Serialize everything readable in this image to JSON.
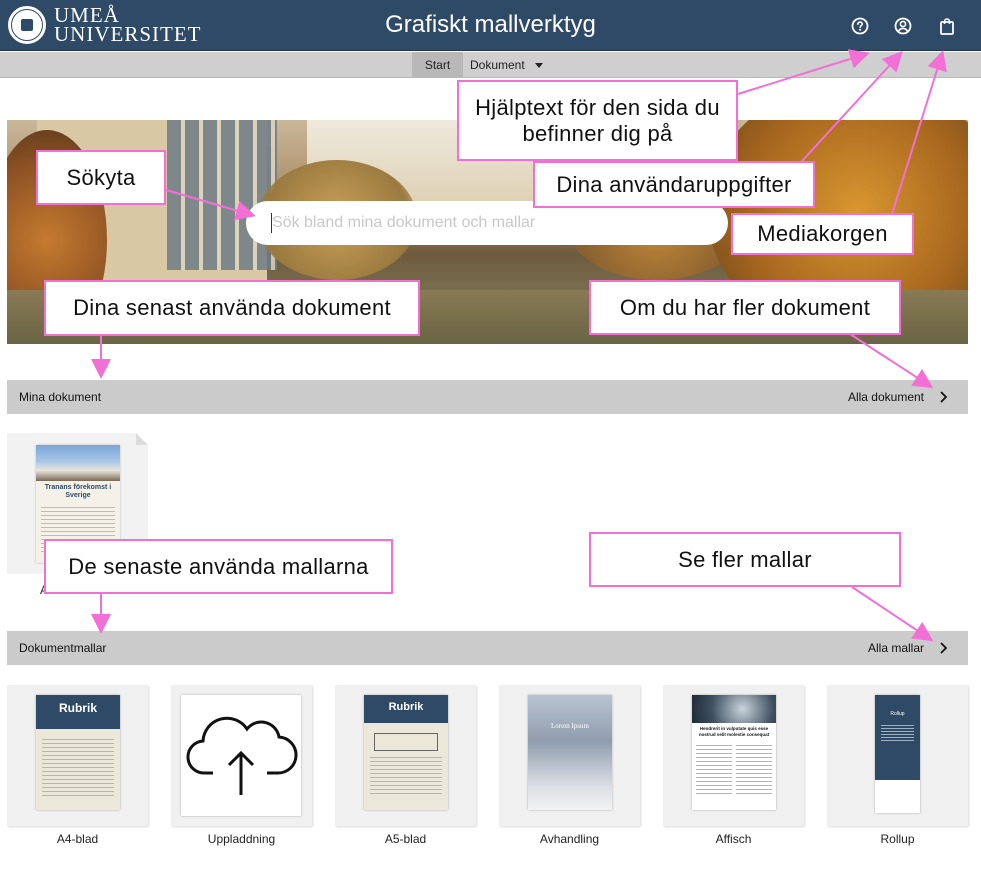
{
  "header": {
    "logo_line1": "UMEÅ",
    "logo_line2": "UNIVERSITET",
    "title": "Grafiskt mallverktyg",
    "icons": [
      "help-icon",
      "user-icon",
      "shopping-bag-icon"
    ]
  },
  "nav": {
    "start_label": "Start",
    "dokument_label": "Dokument"
  },
  "search": {
    "placeholder": "Sök bland mina dokument och mallar"
  },
  "sections": {
    "my_docs": {
      "title": "Mina dokument",
      "link": "Alla dokument"
    },
    "templates": {
      "title": "Dokumentmallar",
      "link": "Alla mallar"
    }
  },
  "recent_doc": {
    "title": "Tranans förekomst i Sverige",
    "name": "A"
  },
  "templates": [
    {
      "label": "A4-blad",
      "thumb_heading": "Rubrik"
    },
    {
      "label": "Uppladdning"
    },
    {
      "label": "A5-blad",
      "thumb_heading": "Rubrik"
    },
    {
      "label": "Avhandling",
      "thumb_heading": "Lorem Ipsum"
    },
    {
      "label": "Affisch",
      "thumb_heading": "Hendrerit in vulputate quis esse nostrud velit molestie consequat"
    },
    {
      "label": "Rollup",
      "thumb_heading": "Rollup"
    }
  ],
  "callouts": {
    "help": "Hjälptext för den sida du befinner dig på",
    "search": "Sökyta",
    "user": "Dina användaruppgifter",
    "media": "Mediakorgen",
    "recent_docs": "Dina senast använda dokument",
    "more_docs": "Om du har fler dokument",
    "recent_templates": "De senaste använda mallarna",
    "more_templates": "Se fler mallar"
  },
  "colors": {
    "header": "#2e4a66",
    "callout_border": "#f26fd6",
    "arrow": "#f26fd6",
    "section_bar": "#cbcbcb"
  }
}
